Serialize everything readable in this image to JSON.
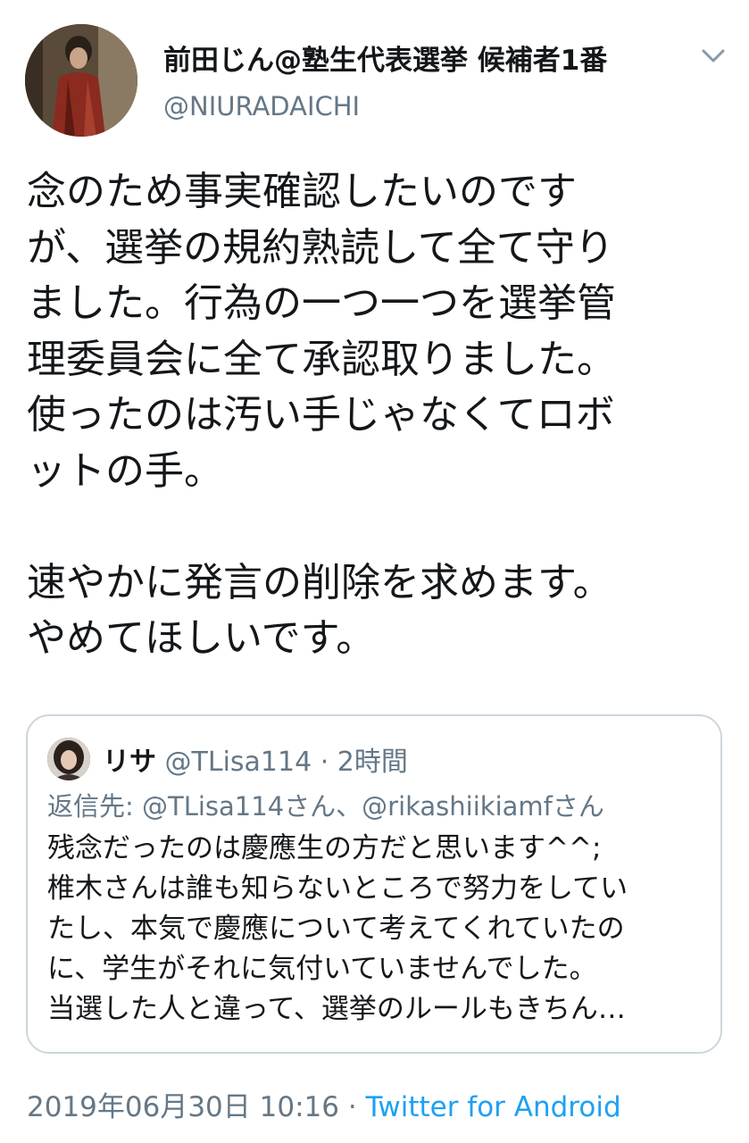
{
  "author": {
    "display_name": "前田じん@塾生代表選挙 候補者1番",
    "handle": "@NIURADAICHI",
    "avatar_icon": "user-avatar-photo"
  },
  "menu": {
    "icon": "chevron-down-icon"
  },
  "tweet": {
    "text": "念のため事実確認したいのです\nが、選挙の規約熟読して全て守り\nました。行為の一つ一つを選挙管\n理委員会に全て承認取りました。\n使ったのは汚い手じゃなくてロボ\nットの手。\n\n速やかに発言の削除を求めます。\nやめてほしいです。"
  },
  "quote": {
    "name": "リサ",
    "meta": "@TLisa114 · 2時間",
    "reply_to": "返信先: @TLisa114さん、@rikashiikiamfさん",
    "text": "残念だったのは慶應生の方だと思います^^;\n椎木さんは誰も知らないところで努力をしてい\nたし、本気で慶應について考えてくれていたの\nに、学生がそれに気付いていませんでした。\n当選した人と違って、選挙のルールもきちん…"
  },
  "footer": {
    "timestamp": "2019年06月30日 10:16 · ",
    "source": "Twitter for Android"
  },
  "colors": {
    "text_primary": "#14171a",
    "text_secondary": "#657786",
    "link": "#1da1f2",
    "border": "#ccd6dd"
  }
}
